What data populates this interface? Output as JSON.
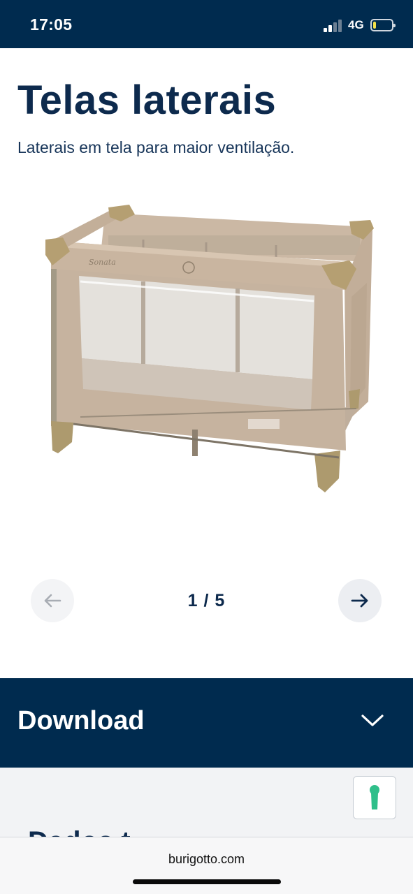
{
  "status_bar": {
    "time": "17:05",
    "network": "4G",
    "signal_bars_active": 2,
    "signal_bars_total": 4,
    "battery_level": 0.15
  },
  "page": {
    "title": "Telas laterais",
    "subtitle": "Laterais em tela para maior ventilação."
  },
  "product_image": {
    "brand_mark": "Sonata"
  },
  "gallery": {
    "pager": "1 / 5",
    "prev_icon": "arrow-left-icon",
    "next_icon": "arrow-right-icon"
  },
  "download": {
    "label": "Download",
    "icon": "chevron-down-icon"
  },
  "next_section": {
    "cut_heading": "Dados t"
  },
  "accessibility": {
    "icon": "accessibility-icon",
    "color": "#2fbf8a"
  },
  "browser": {
    "url": "burigotto.com"
  },
  "colors": {
    "navy": "#002b4f",
    "text_navy": "#0d2a4d",
    "crib_fabric": "#c9b5a0",
    "crib_frame": "#a39a86"
  }
}
